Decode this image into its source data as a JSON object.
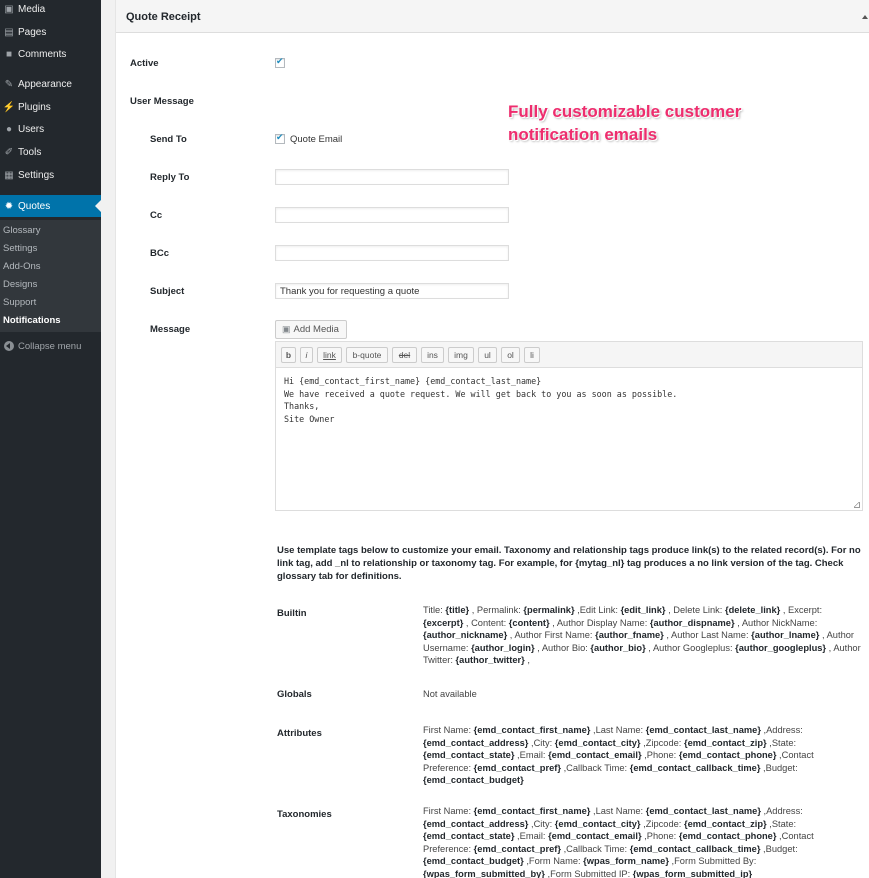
{
  "sidebar": {
    "items": [
      {
        "label": "Media",
        "icon": "media-icon"
      },
      {
        "label": "Pages",
        "icon": "pages-icon"
      },
      {
        "label": "Comments",
        "icon": "comments-icon"
      },
      {
        "label": "Appearance",
        "icon": "appearance-icon"
      },
      {
        "label": "Plugins",
        "icon": "plugins-icon"
      },
      {
        "label": "Users",
        "icon": "users-icon"
      },
      {
        "label": "Tools",
        "icon": "tools-icon"
      },
      {
        "label": "Settings",
        "icon": "settings-icon"
      },
      {
        "label": "Quotes",
        "icon": "gear-icon",
        "active": true
      }
    ],
    "submenu": [
      "Glossary",
      "Settings",
      "Add-Ons",
      "Designs",
      "Support",
      "Notifications"
    ],
    "submenu_current": "Notifications",
    "collapse_label": "Collapse menu",
    "active_color": "#0073aa"
  },
  "panel": {
    "title": "Quote Receipt",
    "active_label": "Active",
    "active_checked": true,
    "user_message_label": "User Message",
    "send_to": {
      "label": "Send To",
      "option_label": "Quote Email",
      "checked": true
    },
    "reply_to": {
      "label": "Reply To",
      "value": ""
    },
    "cc": {
      "label": "Cc",
      "value": ""
    },
    "bcc": {
      "label": "BCc",
      "value": ""
    },
    "subject": {
      "label": "Subject",
      "value": "Thank you for requesting a quote"
    },
    "message": {
      "label": "Message",
      "add_media_label": "Add Media",
      "toolbar": [
        "b",
        "i",
        "link",
        "b-quote",
        "del",
        "ins",
        "img",
        "ul",
        "ol",
        "li"
      ],
      "body": "Hi {emd_contact_first_name} {emd_contact_last_name}\nWe have received a quote request. We will get back to you as soon as possible.\nThanks,\nSite Owner"
    },
    "help_text": "Use template tags below to customize your email. Taxonomy and relationship tags produce link(s) to the related record(s). For no link tag, add _nl to relationship or taxonomy tag. For example, for {mytag_nl} tag produces a no link version of the tag. Check glossary tab for definitions.",
    "tag_groups": [
      {
        "label": "Builtin",
        "tags": [
          [
            "Title",
            "{title}",
            " , "
          ],
          [
            "Permalink",
            "{permalink}",
            " ,"
          ],
          [
            "Edit Link",
            "{edit_link}",
            " , "
          ],
          [
            "Delete Link",
            "{delete_link}",
            " , "
          ],
          [
            "Excerpt",
            "{excerpt}",
            " , "
          ],
          [
            "Content",
            "{content}",
            " , "
          ],
          [
            "Author Display Name",
            "{author_dispname}",
            " , "
          ],
          [
            "Author NickName",
            "{author_nickname}",
            " , "
          ],
          [
            "Author First Name",
            "{author_fname}",
            " , "
          ],
          [
            "Author Last Name",
            "{author_lname}",
            " , "
          ],
          [
            "Author Username",
            "{author_login}",
            " , "
          ],
          [
            "Author Bio",
            "{author_bio}",
            " , "
          ],
          [
            "Author Googleplus",
            "{author_googleplus}",
            " , "
          ],
          [
            "Author Twitter",
            "{author_twitter}",
            " ,"
          ]
        ]
      },
      {
        "label": "Globals",
        "text": "Not available"
      },
      {
        "label": "Attributes",
        "tags": [
          [
            "First Name",
            "{emd_contact_first_name}",
            " ,"
          ],
          [
            "Last Name",
            "{emd_contact_last_name}",
            " ,"
          ],
          [
            "Address",
            "{emd_contact_address}",
            " ,"
          ],
          [
            "City",
            "{emd_contact_city}",
            " ,"
          ],
          [
            "Zipcode",
            "{emd_contact_zip}",
            " ,"
          ],
          [
            "State",
            "{emd_contact_state}",
            " ,"
          ],
          [
            "Email",
            "{emd_contact_email}",
            " ,"
          ],
          [
            "Phone",
            "{emd_contact_phone}",
            " ,"
          ],
          [
            "Contact Preference",
            "{emd_contact_pref}",
            " ,"
          ],
          [
            "Callback Time",
            "{emd_contact_callback_time}",
            " ,"
          ],
          [
            "Budget",
            "{emd_contact_budget}",
            ""
          ]
        ]
      },
      {
        "label": "Taxonomies",
        "tags": [
          [
            "First Name",
            "{emd_contact_first_name}",
            " ,"
          ],
          [
            "Last Name",
            "{emd_contact_last_name}",
            " ,"
          ],
          [
            "Address",
            "{emd_contact_address}",
            " ,"
          ],
          [
            "City",
            "{emd_contact_city}",
            " ,"
          ],
          [
            "Zipcode",
            "{emd_contact_zip}",
            " ,"
          ],
          [
            "State",
            "{emd_contact_state}",
            " ,"
          ],
          [
            "Email",
            "{emd_contact_email}",
            " ,"
          ],
          [
            "Phone",
            "{emd_contact_phone}",
            " ,"
          ],
          [
            "Contact Preference",
            "{emd_contact_pref}",
            " ,"
          ],
          [
            "Callback Time",
            "{emd_contact_callback_time}",
            " ,"
          ],
          [
            "Budget",
            "{emd_contact_budget}",
            " ,"
          ],
          [
            "Form Name",
            "{wpas_form_name}",
            " ,"
          ],
          [
            "Form Submitted By",
            "{wpas_form_submitted_by}",
            " ,"
          ],
          [
            "Form Submitted IP",
            "{wpas_form_submitted_ip}",
            ""
          ]
        ]
      }
    ]
  },
  "promo": {
    "line1": "Fully customizable customer",
    "line2": "notification emails",
    "color": "#ee2d6e"
  }
}
